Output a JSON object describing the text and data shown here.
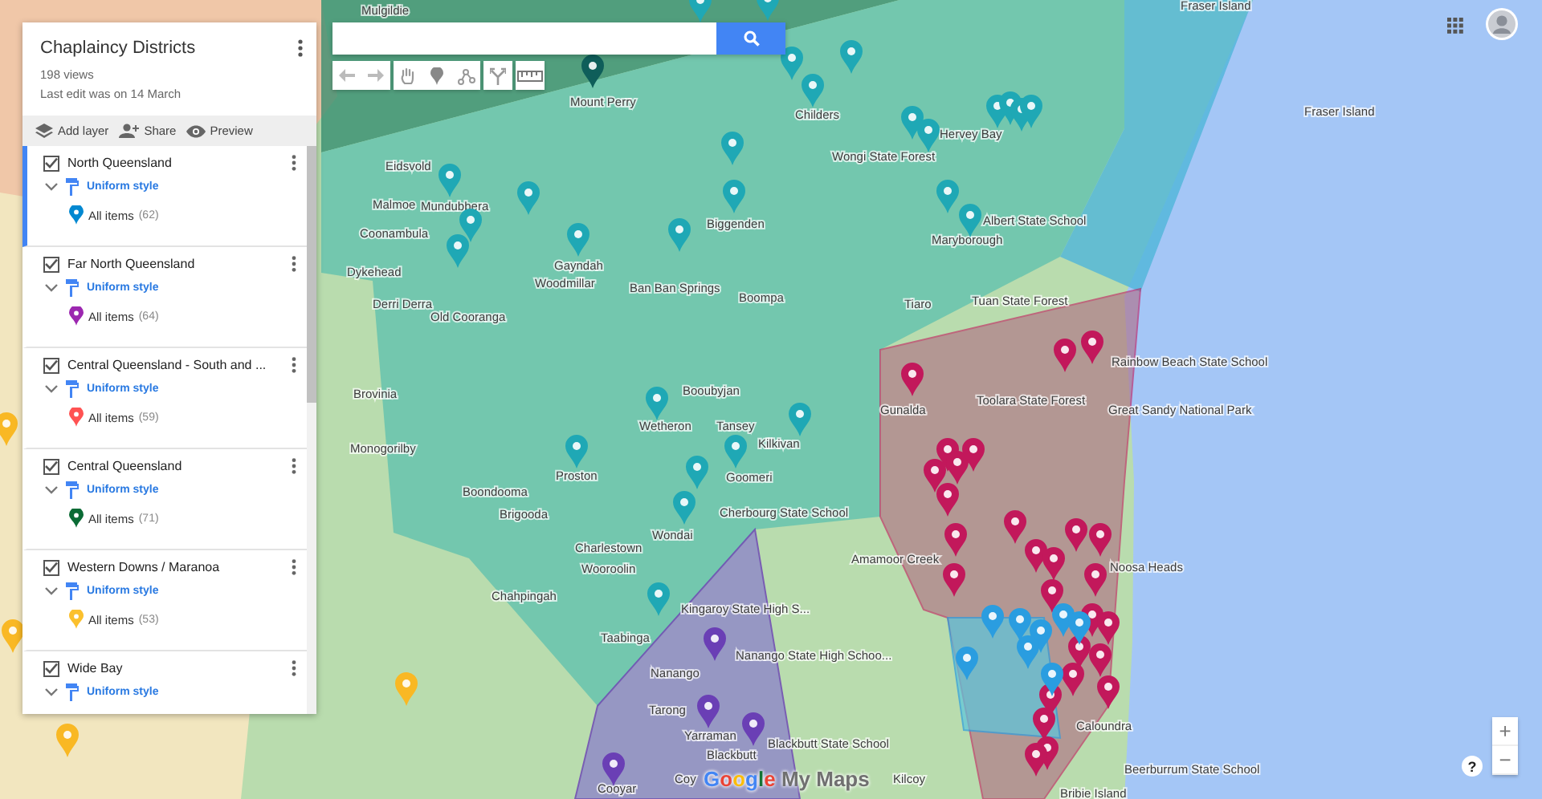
{
  "map_title": "Chaplaincy Districts",
  "views": "198 views",
  "last_edit": "Last edit was on 14 March",
  "actions": [
    {
      "kind": "add_layer",
      "label": "Add layer"
    },
    {
      "kind": "share",
      "label": "Share"
    },
    {
      "kind": "preview",
      "label": "Preview"
    }
  ],
  "layers": [
    {
      "name": "North Queensland",
      "checked": true,
      "selected": true,
      "style": "Uniform style",
      "items_label": "All items",
      "count": "(62)",
      "color": "#0288d1"
    },
    {
      "name": "Far North Queensland",
      "checked": true,
      "selected": false,
      "style": "Uniform style",
      "items_label": "All items",
      "count": "(64)",
      "color": "#9c27b0"
    },
    {
      "name": "Central Queensland - South and ...",
      "checked": true,
      "selected": false,
      "style": "Uniform style",
      "items_label": "All items",
      "count": "(59)",
      "color": "#ff5252"
    },
    {
      "name": "Central Queensland",
      "checked": true,
      "selected": false,
      "style": "Uniform style",
      "items_label": "All items",
      "count": "(71)",
      "color": "#0b6b35"
    },
    {
      "name": "Western Downs / Maranoa",
      "checked": true,
      "selected": false,
      "style": "Uniform style",
      "items_label": "All items",
      "count": "(53)",
      "color": "#fbc02d"
    },
    {
      "name": "Wide Bay",
      "checked": true,
      "selected": false,
      "style": "Uniform style"
    }
  ],
  "map_labels": [
    "Mulgildie",
    "Mount Perry",
    "Childers",
    "Hervey Bay",
    "Fraser Island",
    "Fraser Island",
    "Eidsvold",
    "Malmoe",
    "Mundubbera",
    "Coonambula",
    "Gayndah",
    "Biggenden",
    "Woodmillar",
    "Boompa",
    "Wongi State Forest",
    "Albert State School",
    "Maryborough",
    "Dykehead",
    "Derri Derra",
    "Old Cooranga",
    "Ban Ban Springs",
    "Tiaro",
    "Tuan State Forest",
    "Rainbow Beach State School",
    "Gunalda",
    "Toolara State Forest",
    "Great Sandy National Park",
    "Brovinia",
    "Wetheron",
    "Booubyjan",
    "Tansey",
    "Kilkivan",
    "Monogorilby",
    "Proston",
    "Boondooma",
    "Goomeri",
    "Brigooda",
    "Cherbourg State School",
    "Wondai",
    "Charlestown",
    "Amamoor Creek",
    "Noosa Heads",
    "Wooroolin",
    "Chahpingah",
    "Kingaroy State High S...",
    "Taabinga",
    "Nanango State High Schoo...",
    "Nanango",
    "Tarong",
    "Yarraman",
    "Blackbutt State School",
    "Blackbutt",
    "Cooyar",
    "Coy",
    "Kilcoy",
    "Caloundra",
    "Beerburrum State School",
    "Bribie Island"
  ],
  "branding": {
    "logo": "Google",
    "product": "My Maps"
  },
  "help": "?",
  "zoom": [
    "+",
    "−"
  ]
}
